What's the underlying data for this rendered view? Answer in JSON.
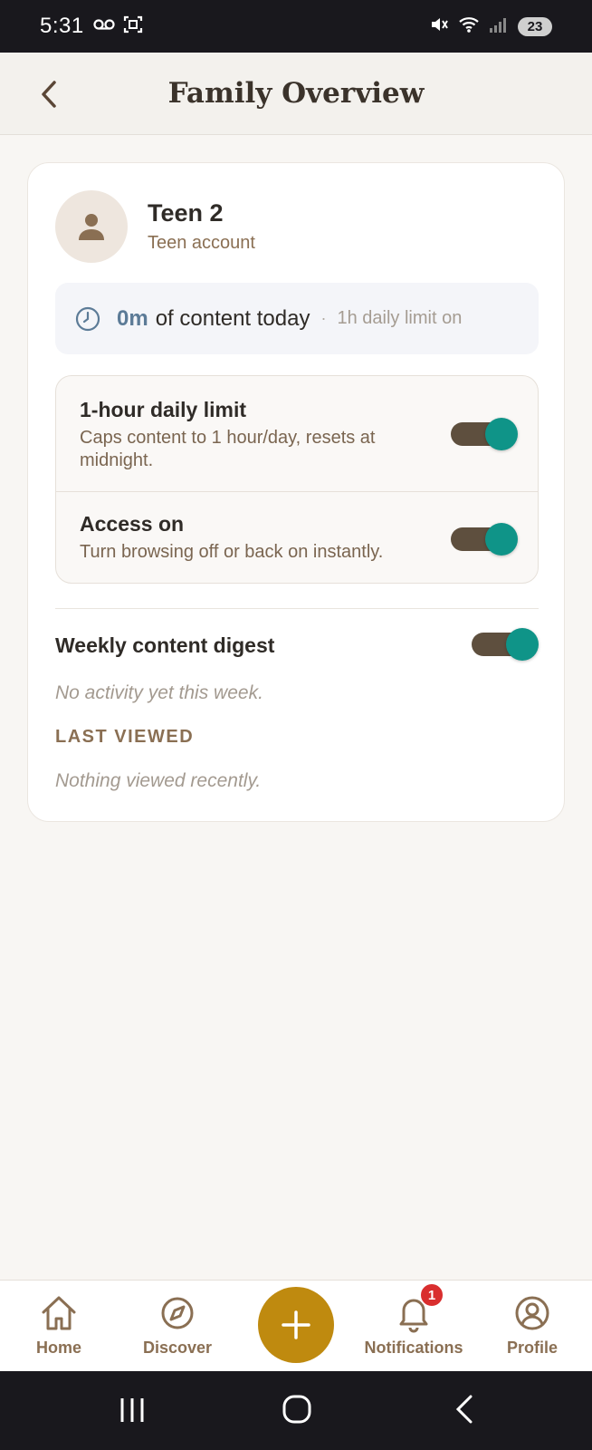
{
  "status_bar": {
    "time": "5:31",
    "battery": "23"
  },
  "header": {
    "title": "Family Overview"
  },
  "profile": {
    "name": "Teen 2",
    "account_type": "Teen account"
  },
  "usage": {
    "amount": "0m",
    "text": "of content today",
    "separator": "·",
    "limit_text": "1h daily limit on"
  },
  "settings": [
    {
      "title": "1-hour daily limit",
      "description": "Caps content to 1 hour/day, resets at midnight.",
      "enabled": true
    },
    {
      "title": "Access on",
      "description": "Turn browsing off or back on instantly.",
      "enabled": true
    }
  ],
  "digest": {
    "title": "Weekly content digest",
    "enabled": true,
    "empty_text": "No activity yet this week."
  },
  "last_viewed": {
    "heading": "LAST VIEWED",
    "empty_text": "Nothing viewed recently."
  },
  "bottom_nav": {
    "items": [
      {
        "label": "Home",
        "icon": "home-icon"
      },
      {
        "label": "Discover",
        "icon": "compass-icon"
      },
      {
        "label": "Notifications",
        "icon": "bell-icon",
        "badge": "1"
      },
      {
        "label": "Profile",
        "icon": "user-circle-icon"
      }
    ],
    "fab_icon": "plus-icon"
  },
  "colors": {
    "accent": "#bf8a0f",
    "toggle_on": "#0f9488",
    "badge": "#d92e2e",
    "brown": "#8a6f53"
  }
}
